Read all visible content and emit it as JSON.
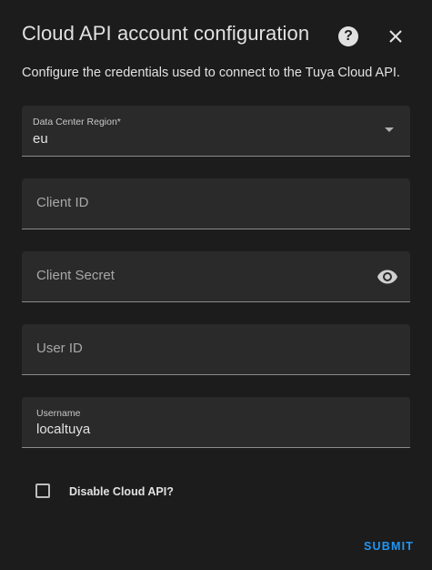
{
  "dialog": {
    "title": "Cloud API account configuration",
    "help_icon": "help-circle-icon",
    "close_icon": "close-icon",
    "description": "Configure the credentials used to connect to the Tuya Cloud API."
  },
  "fields": {
    "region": {
      "label": "Data Center Region*",
      "value": "eu"
    },
    "client_id": {
      "label": "Client ID",
      "value": ""
    },
    "client_secret": {
      "label": "Client Secret",
      "value": "",
      "icon": "eye-icon"
    },
    "user_id": {
      "label": "User ID",
      "value": ""
    },
    "username": {
      "label": "Username",
      "value": "localtuya"
    }
  },
  "disable_cloud": {
    "label": "Disable Cloud API?",
    "checked": false
  },
  "actions": {
    "submit_label": "SUBMIT"
  },
  "colors": {
    "background": "#1c1c1c",
    "field": "#2a2a2a",
    "accent": "#2196f3"
  }
}
